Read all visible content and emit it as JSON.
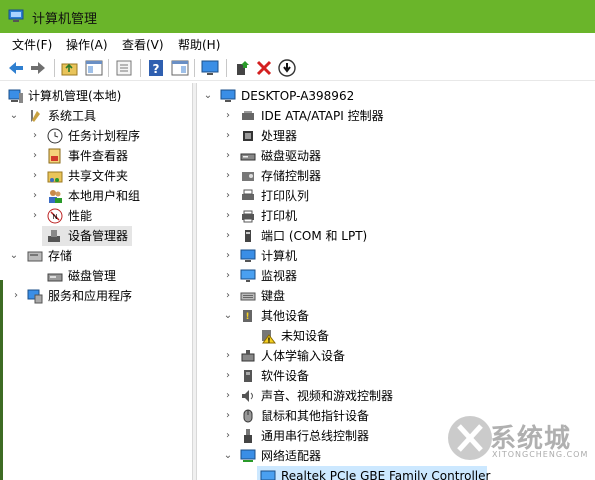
{
  "window": {
    "title": "计算机管理"
  },
  "menu": {
    "file": "文件(F)",
    "action": "操作(A)",
    "view": "查看(V)",
    "help": "帮助(H)"
  },
  "toolbar": {
    "icons": [
      "back-icon",
      "forward-icon",
      "up-folder-icon",
      "show-tree-icon",
      "properties-icon",
      "help-icon",
      "show-action-pane-icon",
      "monitor-icon",
      "update-driver-icon",
      "uninstall-icon",
      "disable-device-icon"
    ]
  },
  "left_tree": {
    "root": "计算机管理(本地)",
    "system_tools": "系统工具",
    "task_scheduler": "任务计划程序",
    "event_viewer": "事件查看器",
    "shared_folders": "共享文件夹",
    "local_users": "本地用户和组",
    "performance": "性能",
    "device_manager": "设备管理器",
    "storage": "存储",
    "disk_management": "磁盘管理",
    "services_apps": "服务和应用程序"
  },
  "right_tree": {
    "root": "DESKTOP-A398962",
    "items": [
      {
        "label": "IDE ATA/ATAPI 控制器",
        "icon": "ide-controller-icon",
        "state": "collapsed"
      },
      {
        "label": "处理器",
        "icon": "processor-icon",
        "state": "collapsed"
      },
      {
        "label": "磁盘驱动器",
        "icon": "disk-drive-icon",
        "state": "collapsed"
      },
      {
        "label": "存储控制器",
        "icon": "storage-controller-icon",
        "state": "collapsed"
      },
      {
        "label": "打印队列",
        "icon": "print-queue-icon",
        "state": "collapsed"
      },
      {
        "label": "打印机",
        "icon": "printer-icon",
        "state": "collapsed"
      },
      {
        "label": "端口 (COM 和 LPT)",
        "icon": "port-icon",
        "state": "collapsed"
      },
      {
        "label": "计算机",
        "icon": "computer-icon",
        "state": "collapsed"
      },
      {
        "label": "监视器",
        "icon": "monitor-icon",
        "state": "collapsed"
      },
      {
        "label": "键盘",
        "icon": "keyboard-icon",
        "state": "collapsed"
      },
      {
        "label": "其他设备",
        "icon": "other-devices-icon",
        "state": "expanded"
      },
      {
        "label": "未知设备",
        "icon": "unknown-device-warning-icon",
        "state": "child"
      },
      {
        "label": "人体学输入设备",
        "icon": "hid-icon",
        "state": "collapsed"
      },
      {
        "label": "软件设备",
        "icon": "software-device-icon",
        "state": "collapsed"
      },
      {
        "label": "声音、视频和游戏控制器",
        "icon": "sound-icon",
        "state": "collapsed"
      },
      {
        "label": "鼠标和其他指针设备",
        "icon": "mouse-icon",
        "state": "collapsed"
      },
      {
        "label": "通用串行总线控制器",
        "icon": "usb-icon",
        "state": "collapsed"
      },
      {
        "label": "网络适配器",
        "icon": "network-adapter-icon",
        "state": "expanded"
      },
      {
        "label": "Realtek PCIe GBE Family Controller",
        "icon": "network-card-icon",
        "state": "child-selected"
      }
    ]
  },
  "watermark": {
    "main": "系统城",
    "sub": "XITONGCHENG.COM"
  },
  "colors": {
    "titlebar": "#6ab52a",
    "selection_blue": "#cce8ff",
    "selection_gray": "#e5e5e5"
  }
}
